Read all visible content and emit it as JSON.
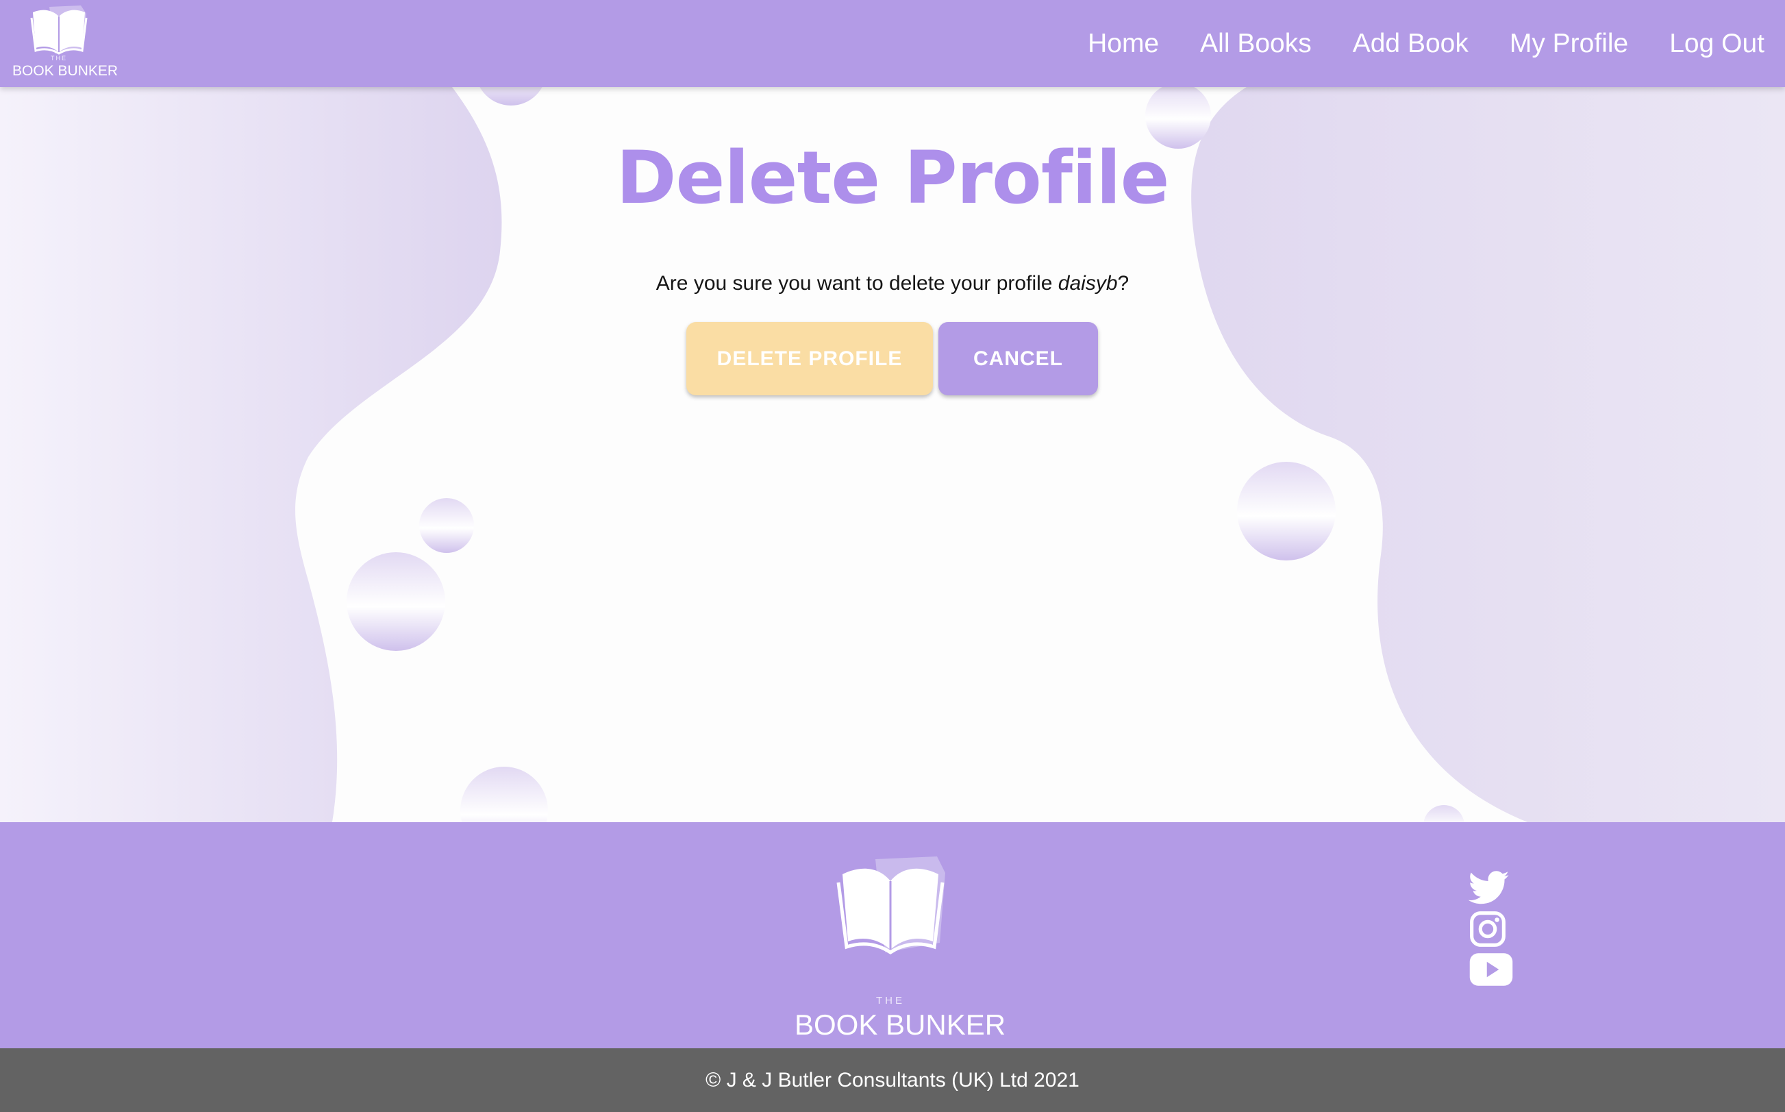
{
  "brand": {
    "the": "THE",
    "name": "BOOK BUNKER"
  },
  "nav": {
    "items": [
      {
        "label": "Home"
      },
      {
        "label": "All Books"
      },
      {
        "label": "Add Book"
      },
      {
        "label": "My Profile"
      },
      {
        "label": "Log Out"
      }
    ]
  },
  "main": {
    "title": "Delete Profile",
    "confirm_prefix": "Are you sure you want to delete your profile ",
    "username": "daisyb",
    "confirm_suffix": "?",
    "delete_label": "DELETE PROFILE",
    "cancel_label": "CANCEL"
  },
  "footer": {
    "social": [
      "twitter-icon",
      "instagram-icon",
      "youtube-icon"
    ]
  },
  "copyright": "© J & J Butler Consultants (UK) Ltd 2021",
  "colors": {
    "primary": "#b39be6",
    "title": "#ad8feb",
    "delete_button": "#fadda4",
    "copyright_bar": "#636363"
  }
}
